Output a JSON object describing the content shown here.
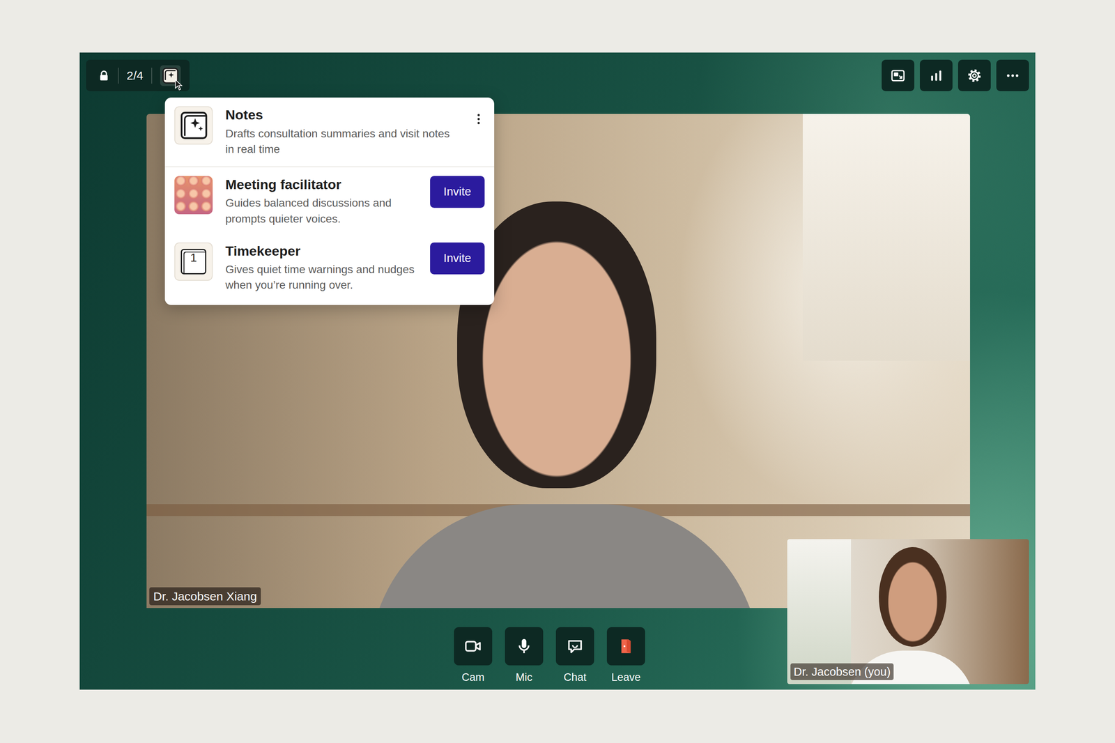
{
  "toolbar": {
    "locked": true,
    "participants": "2/4",
    "apps_open": true
  },
  "apps_menu": {
    "items": [
      {
        "name": "Notes",
        "description": "Drafts consultation summaries and visit notes in real time",
        "kind": "installed",
        "icon": "sparkle"
      },
      {
        "name": "Meeting facilitator",
        "description": "Guides balanced discussions and prompts quieter voices.",
        "kind": "available",
        "icon": "pattern",
        "action": "Invite"
      },
      {
        "name": "Timekeeper",
        "description": "Gives quiet time warnings and nudges when you’re running over.",
        "kind": "available",
        "icon": "number",
        "icon_glyph": "1",
        "action": "Invite"
      }
    ]
  },
  "main_video": {
    "label": "Dr. Jacobsen Xiang"
  },
  "self_video": {
    "label": "Dr. Jacobsen (you)"
  },
  "controls": [
    {
      "label": "Cam",
      "kind": "cam"
    },
    {
      "label": "Mic",
      "kind": "mic"
    },
    {
      "label": "Chat",
      "kind": "chat"
    },
    {
      "label": "Leave",
      "kind": "leave"
    }
  ]
}
